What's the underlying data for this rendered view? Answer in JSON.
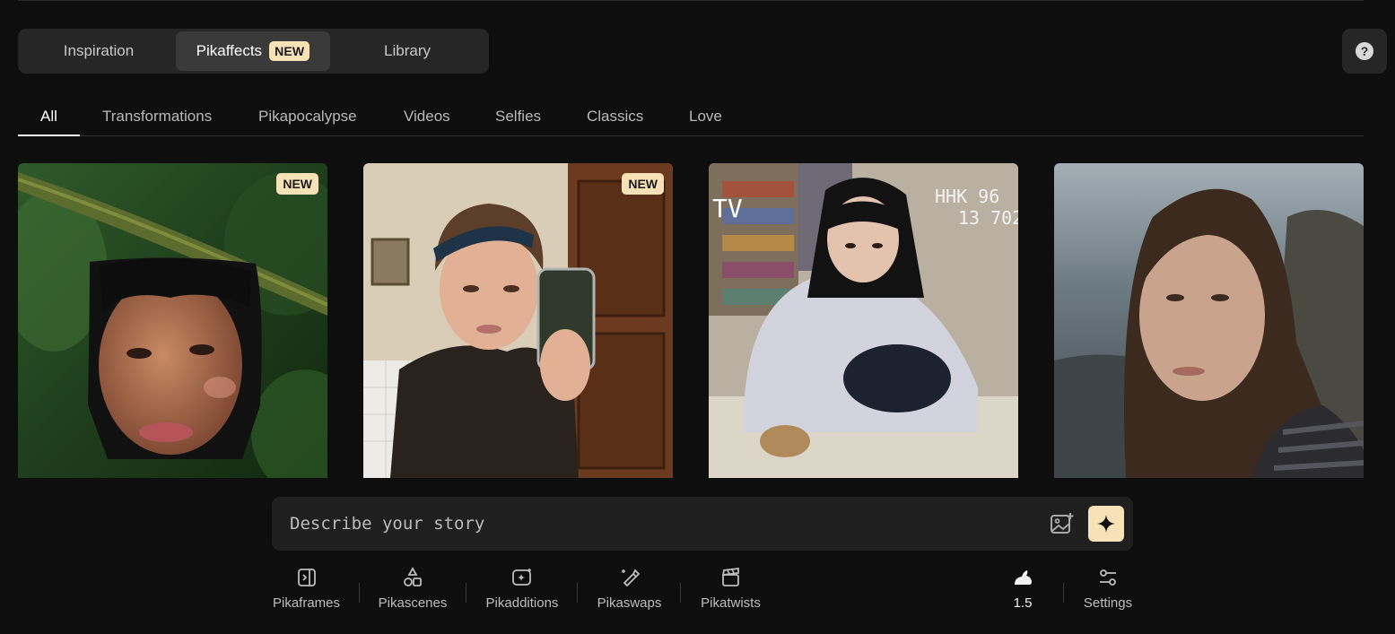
{
  "main_tabs": [
    {
      "label": "Inspiration"
    },
    {
      "label": "Pikaffects",
      "badge": "NEW"
    },
    {
      "label": "Library"
    }
  ],
  "help_label": "?",
  "filters": [
    "All",
    "Transformations",
    "Pikapocalypse",
    "Videos",
    "Selfies",
    "Classics",
    "Love"
  ],
  "cards": [
    {
      "badge": "NEW",
      "subject": "woman-jungle"
    },
    {
      "badge": "NEW",
      "subject": "mirror-selfie"
    },
    {
      "overlay_text": "TV",
      "overlay_date_1": "HHK 96",
      "overlay_date_2": "13 702",
      "subject": "girl-store"
    },
    {
      "subject": "woman-coast"
    }
  ],
  "prompt": {
    "placeholder": "Describe your story"
  },
  "toolbar": [
    {
      "label": "Pikaframes",
      "icon": "frames-icon"
    },
    {
      "label": "Pikascenes",
      "icon": "shapes-icon"
    },
    {
      "label": "Pikadditions",
      "icon": "sparkle-box-icon"
    },
    {
      "label": "Pikaswaps",
      "icon": "brush-icon"
    },
    {
      "label": "Pikatwists",
      "icon": "clapper-icon"
    }
  ],
  "model": {
    "label": "1.5",
    "icon": "rabbit-icon"
  },
  "settings": {
    "label": "Settings",
    "icon": "sliders-icon"
  },
  "colors": {
    "accent": "#f7e2b8",
    "background": "#0e0e0e",
    "panel": "#262626"
  }
}
